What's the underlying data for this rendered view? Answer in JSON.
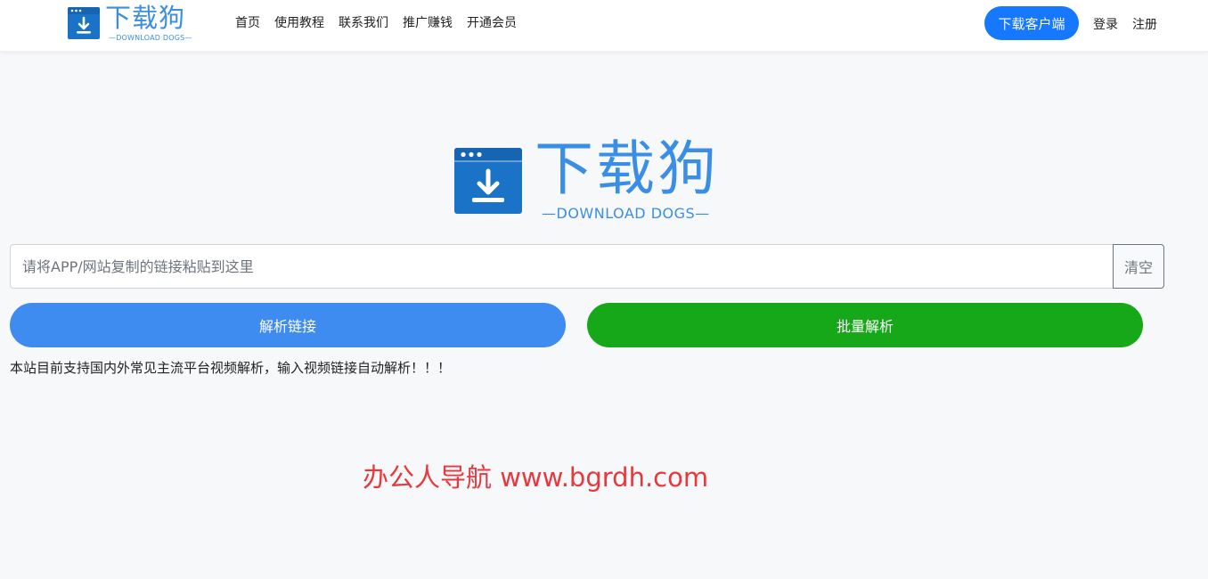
{
  "header": {
    "logo_text": "下载狗",
    "logo_subtitle": "—DOWNLOAD DOGS—",
    "nav": [
      "首页",
      "使用教程",
      "联系我们",
      "推广赚钱",
      "开通会员"
    ],
    "client_button": "下载客户端",
    "login": "登录",
    "register": "注册"
  },
  "hero_logo": {
    "text": "下载狗",
    "subtitle": "—DOWNLOAD DOGS—"
  },
  "search": {
    "placeholder": "请将APP/网站复制的链接粘贴到这里",
    "value": "",
    "clear_label": "清空"
  },
  "actions": {
    "parse_label": "解析链接",
    "batch_label": "批量解析"
  },
  "notice": "本站目前支持国内外常见主流平台视频解析，输入视频链接自动解析！！！",
  "watermark": "办公人导航 www.bgrdh.com",
  "colors": {
    "brand": "#3a8ee6",
    "primary": "#1677ff",
    "parse": "#3f8cf0",
    "batch": "#17a81a",
    "watermark": "#e8383d"
  }
}
